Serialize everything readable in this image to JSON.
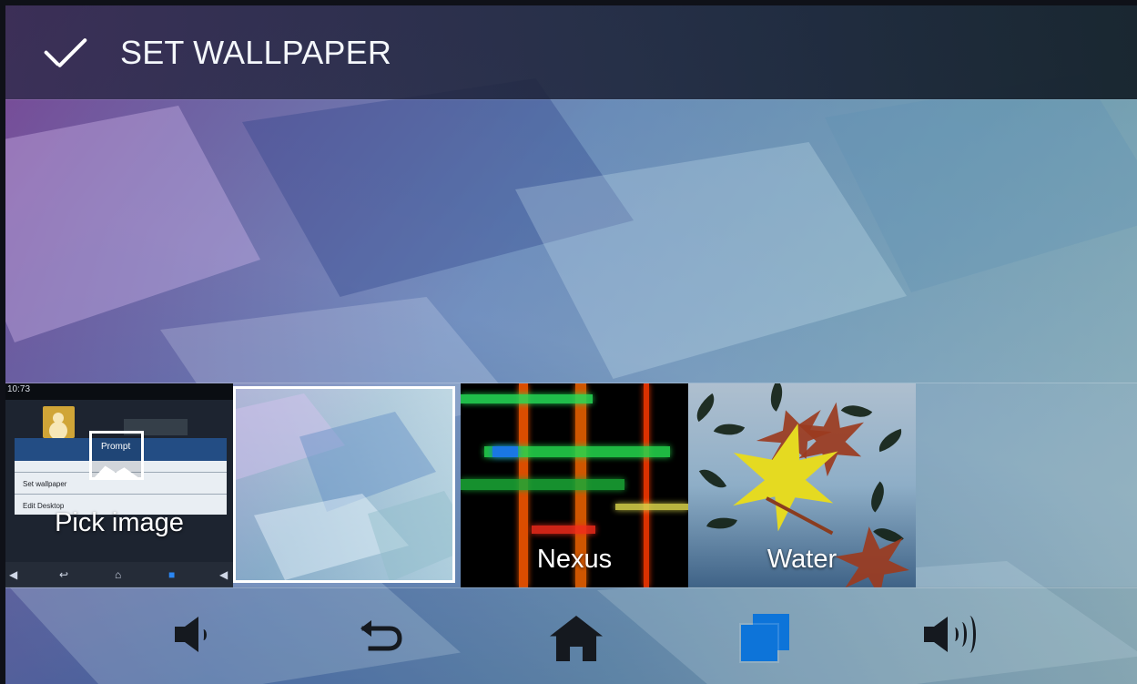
{
  "action_bar": {
    "title": "SET WALLPAPER",
    "check_icon": "check-icon",
    "background": "#1f2534"
  },
  "wallpapers": [
    {
      "id": "pick-image",
      "label": "Pick image",
      "preview": {
        "status_time": "10:73",
        "prompt_text": "Prompt",
        "menu_items": [
          "Set wallpaper",
          "Edit Desktop"
        ]
      }
    },
    {
      "id": "current",
      "label": "",
      "selected": true
    },
    {
      "id": "nexus",
      "label": "Nexus"
    },
    {
      "id": "water",
      "label": "Water"
    }
  ],
  "navigation": {
    "icons": [
      "volume-down-icon",
      "back-icon",
      "home-icon",
      "recent-apps-icon",
      "volume-up-icon"
    ],
    "accent": "#0d74d9",
    "icon_color": "#15191f"
  }
}
